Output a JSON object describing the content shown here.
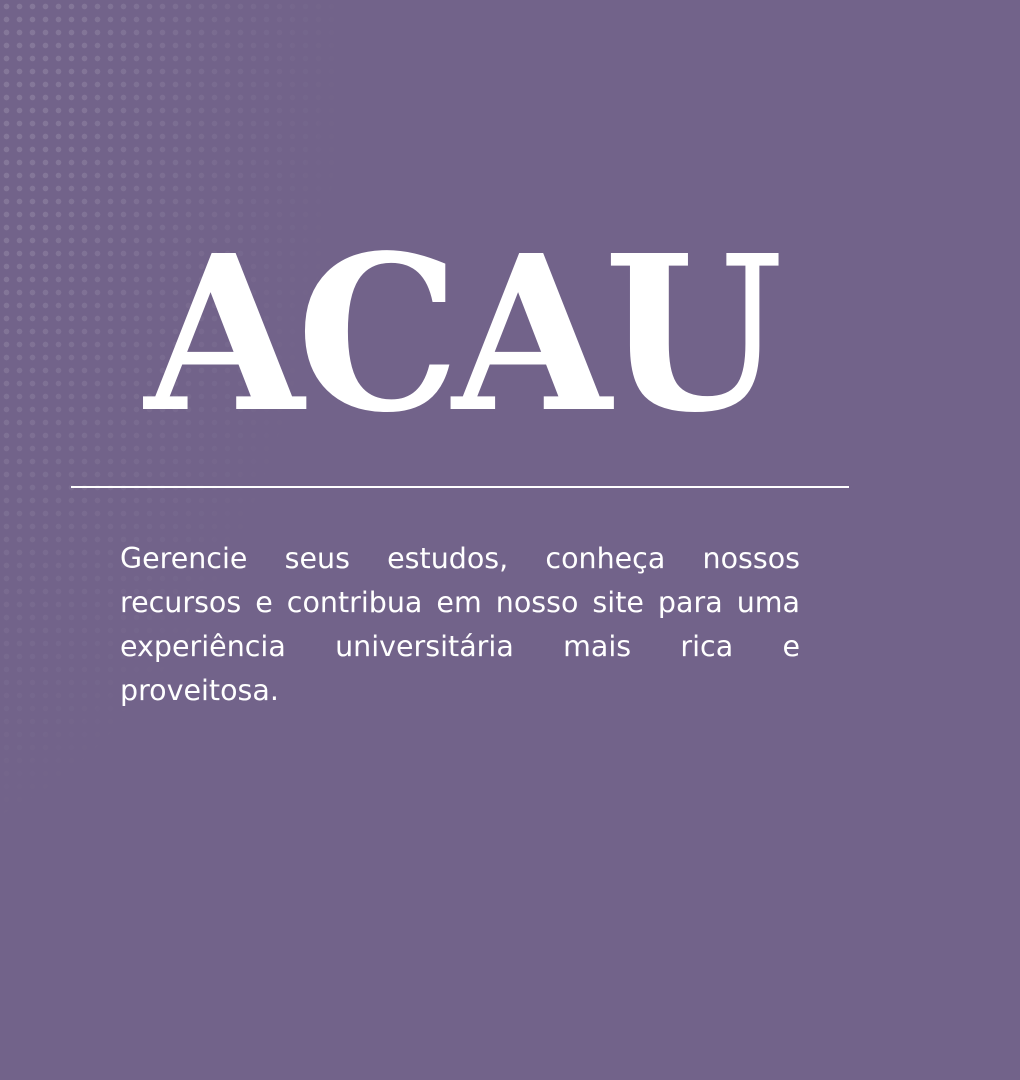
{
  "theme": {
    "background_color": "#72638a",
    "text_color": "#ffffff",
    "divider_color": "#ffffff"
  },
  "hero": {
    "title": "ACAU",
    "tagline": "Gerencie seus estudos, conheça nossos recursos e contribua em nosso site para uma experiência universitária mais rica e proveitosa."
  }
}
